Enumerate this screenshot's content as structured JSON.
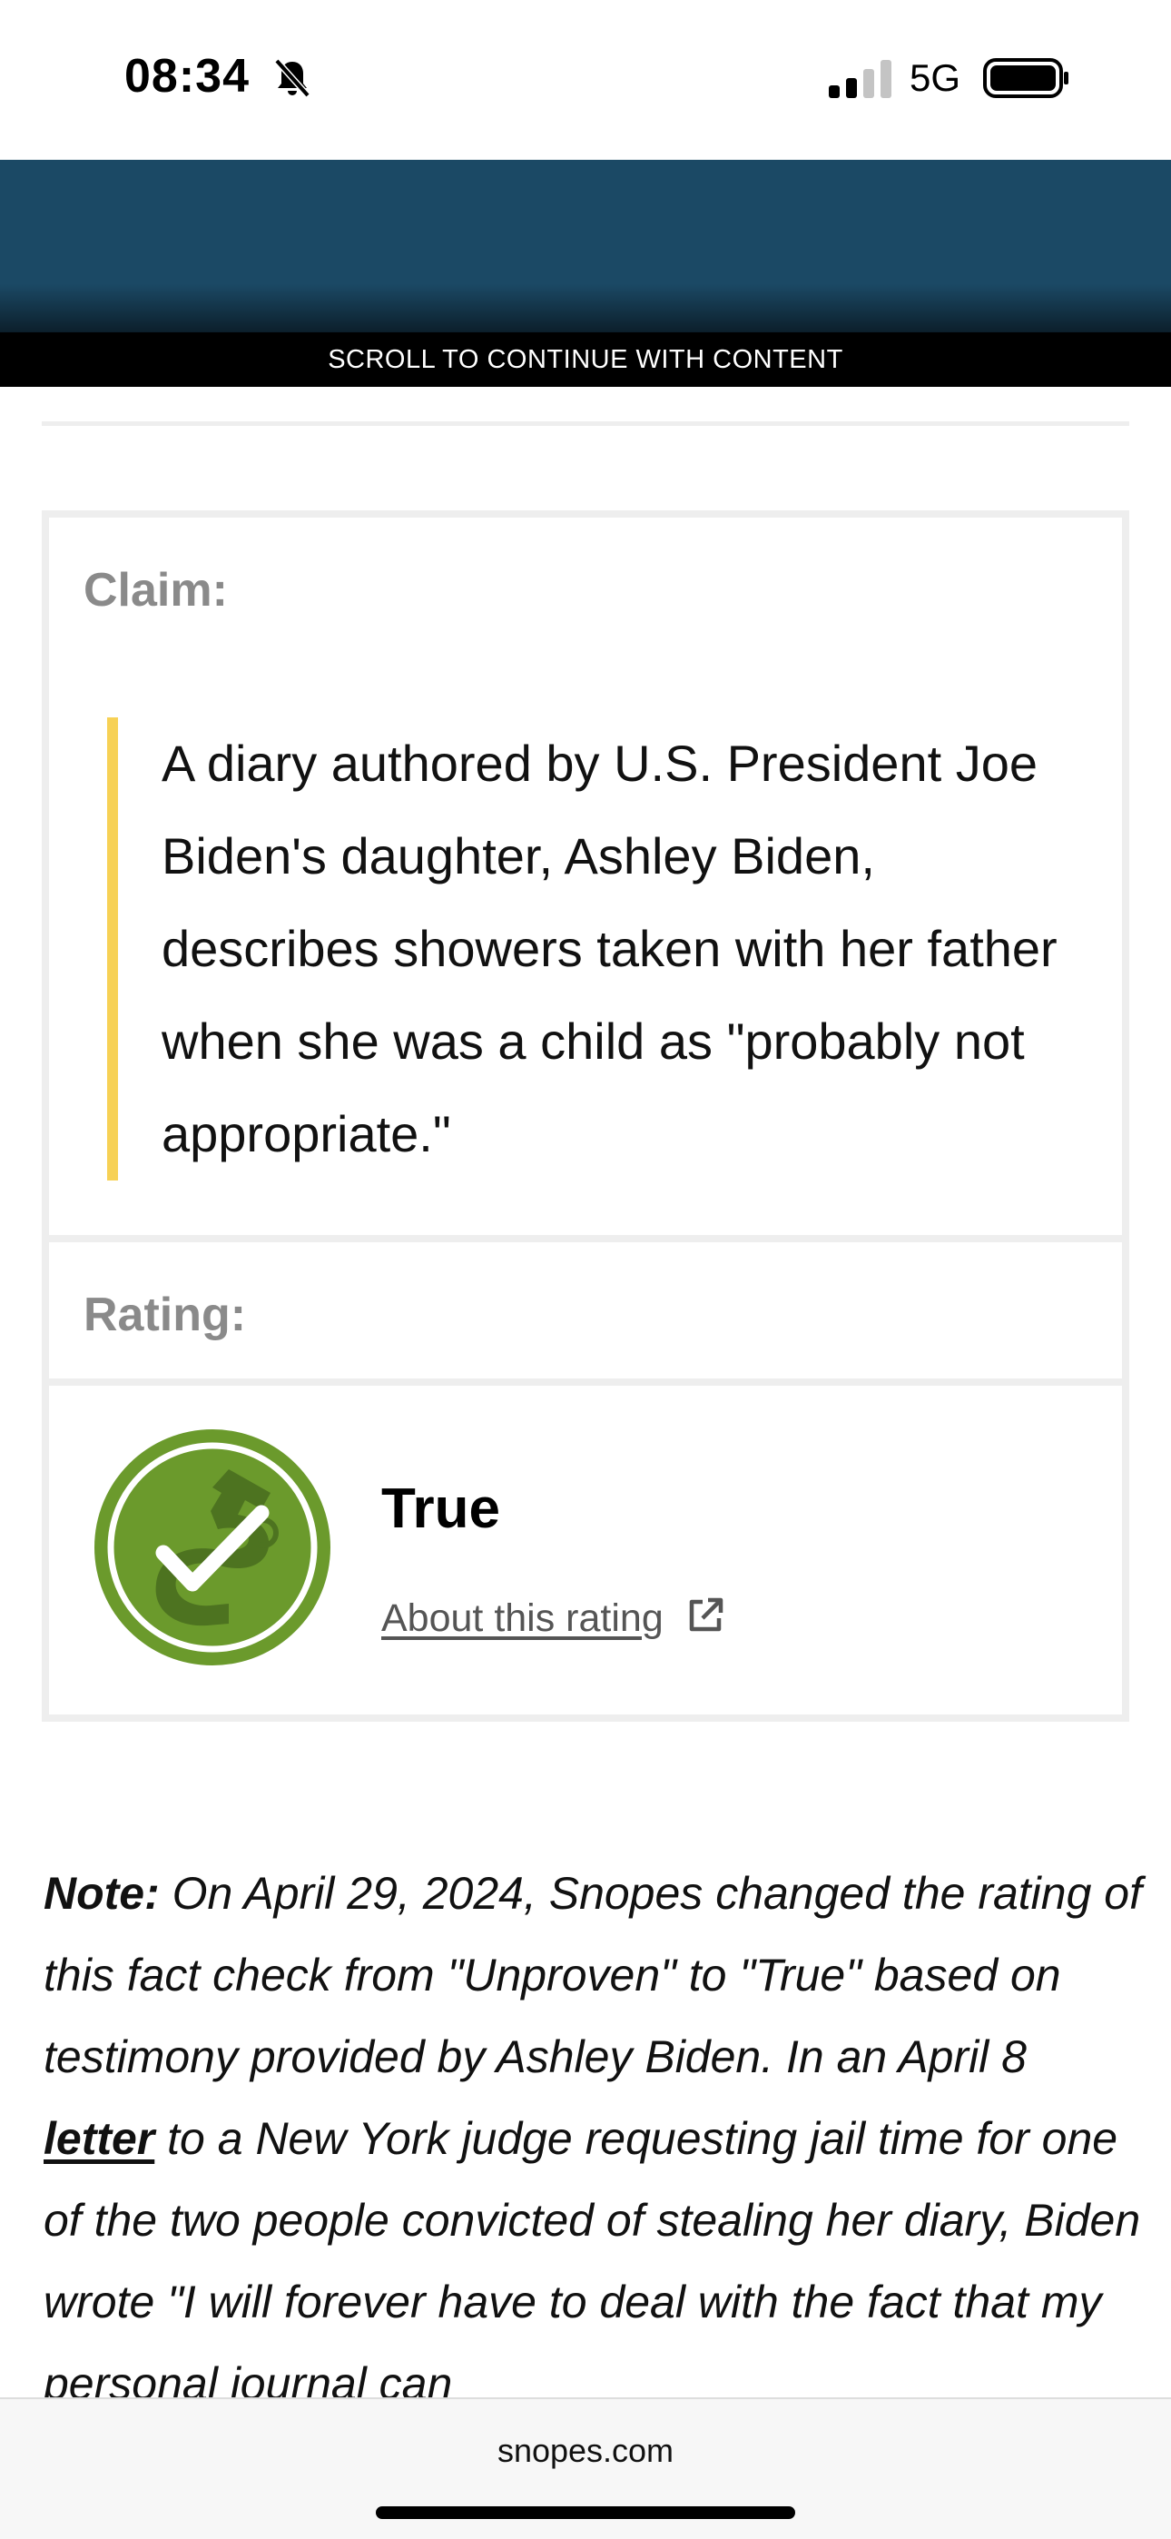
{
  "status_bar": {
    "time": "08:34",
    "network": "5G",
    "icons": [
      "bell-slash-icon",
      "signal-icon",
      "battery-icon"
    ]
  },
  "ad": {
    "banner_color": "#1b4965",
    "scroll_notice": "SCROLL TO CONTINUE WITH CONTENT"
  },
  "claim": {
    "label": "Claim:",
    "text": "A diary authored by U.S. President Joe Biden's daughter, Ashley Biden, describes showers taken with her father when she was a child as \"probably not appropriate.\"",
    "accent_color": "#f7d155"
  },
  "rating": {
    "label": "Rating:",
    "value": "True",
    "about_link": "About this rating",
    "badge_color": "#6b9a2c",
    "badge_icon": "true-check-badge-icon"
  },
  "note": {
    "label": "Note:",
    "text_before_link": " On April 29, 2024, Snopes changed the rating of this fact check from \"Unproven\" to \"True\" based on testimony provided by Ashley Biden. In an April 8 ",
    "link_text": "letter",
    "text_after_link": " to a New York judge requesting jail time for one of the two people convicted of stealing her diary, Biden wrote \"I will forever have to deal with the fact that my personal journal can"
  },
  "browser": {
    "domain": "snopes.com"
  }
}
